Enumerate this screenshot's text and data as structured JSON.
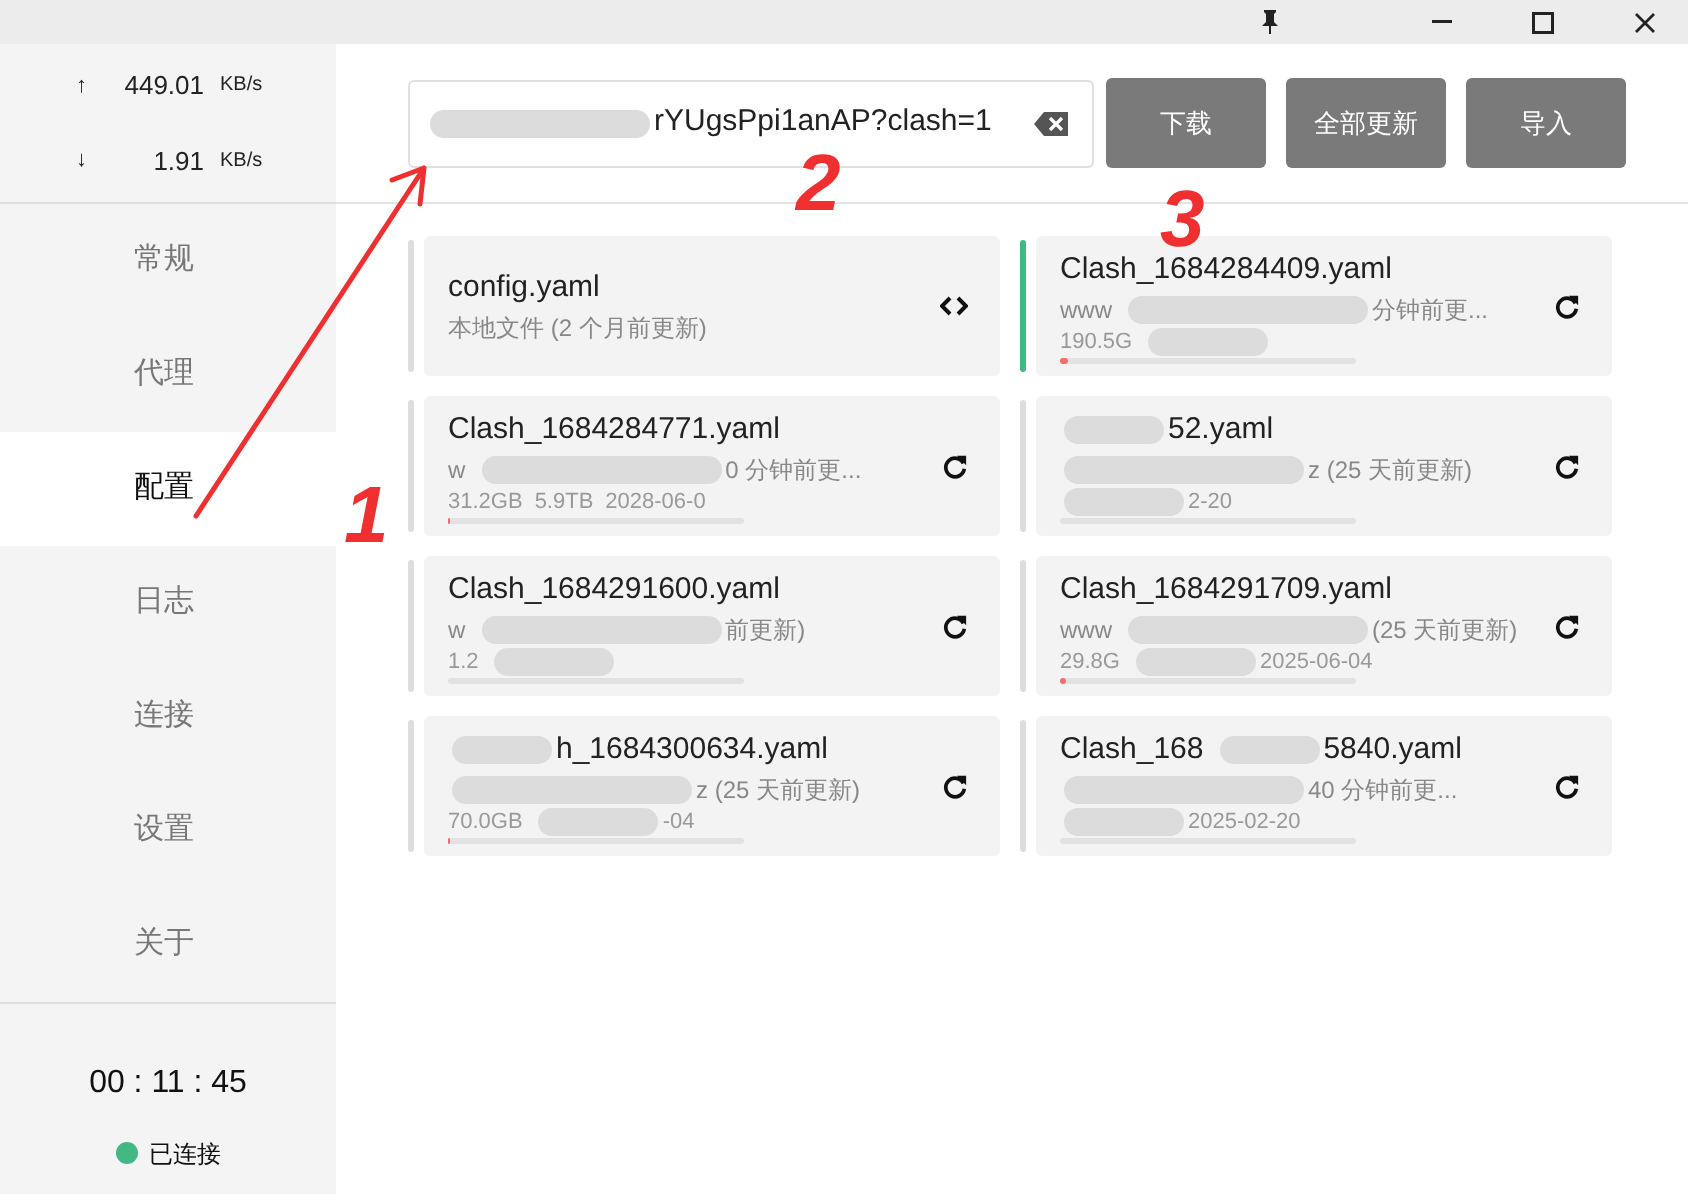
{
  "traffic": {
    "upload": {
      "arrow": "↑",
      "value": "449.01",
      "unit": "KB/s"
    },
    "download": {
      "arrow": "↓",
      "value": "1.91",
      "unit": "KB/s"
    }
  },
  "nav": [
    {
      "label": "常规",
      "selected": false
    },
    {
      "label": "代理",
      "selected": false
    },
    {
      "label": "配置",
      "selected": true
    },
    {
      "label": "日志",
      "selected": false
    },
    {
      "label": "连接",
      "selected": false
    },
    {
      "label": "设置",
      "selected": false
    },
    {
      "label": "关于",
      "selected": false
    }
  ],
  "timer": "00 : 11 : 45",
  "status": {
    "label": "已连接",
    "color": "#42b983"
  },
  "url_field": {
    "value": "rYUgsPpi1anAP?clash=1"
  },
  "buttons": [
    "下载",
    "全部更新",
    "导入"
  ],
  "profiles": [
    {
      "kind": "local",
      "selected": false,
      "title": [
        {
          "kind": "text",
          "text": "config.yaml"
        }
      ],
      "detail": [
        {
          "kind": "text",
          "text": "本地文件 (2 个月前更新)"
        }
      ]
    },
    {
      "kind": "remote",
      "selected": true,
      "title": [
        {
          "kind": "text",
          "text": "Clash_1684284409.yaml"
        }
      ],
      "detail": [
        {
          "kind": "text",
          "text": "www"
        },
        {
          "kind": "redacted"
        },
        {
          "kind": "text",
          "text": "分钟前更..."
        }
      ],
      "stats": [
        {
          "kind": "text",
          "text": "190.5G"
        },
        {
          "kind": "redacted"
        }
      ],
      "level": 0.03
    },
    {
      "kind": "remote",
      "selected": false,
      "title": [
        {
          "kind": "text",
          "text": "Clash_1684284771.yaml"
        }
      ],
      "detail": [
        {
          "kind": "text",
          "text": "w"
        },
        {
          "kind": "redacted"
        },
        {
          "kind": "text",
          "text": "0 分钟前更..."
        }
      ],
      "stats": [
        {
          "kind": "text",
          "text": "31.2GB"
        },
        {
          "kind": "text",
          "text": "5.9TB"
        },
        {
          "kind": "text",
          "text": "2028-06-0"
        }
      ],
      "level": 0.01
    },
    {
      "kind": "remote",
      "selected": false,
      "title": [
        {
          "kind": "redacted"
        },
        {
          "kind": "text",
          "text": "52.yaml"
        }
      ],
      "detail": [
        {
          "kind": "redacted"
        },
        {
          "kind": "text",
          "text": "z (25 天前更新)"
        }
      ],
      "stats": [
        {
          "kind": "redacted"
        },
        {
          "kind": "text",
          "text": "2-20"
        }
      ]
    },
    {
      "kind": "remote",
      "selected": false,
      "title": [
        {
          "kind": "text",
          "text": "Clash_1684291600.yaml"
        }
      ],
      "detail": [
        {
          "kind": "text",
          "text": "w"
        },
        {
          "kind": "redacted"
        },
        {
          "kind": "text",
          "text": "前更新)"
        }
      ],
      "stats": [
        {
          "kind": "text",
          "text": "1.2"
        },
        {
          "kind": "redacted"
        }
      ]
    },
    {
      "kind": "remote",
      "selected": false,
      "title": [
        {
          "kind": "text",
          "text": "Clash_1684291709.yaml"
        }
      ],
      "detail": [
        {
          "kind": "text",
          "text": "www"
        },
        {
          "kind": "redacted"
        },
        {
          "kind": "text",
          "text": "(25 天前更新)"
        }
      ],
      "stats": [
        {
          "kind": "text",
          "text": "29.8G"
        },
        {
          "kind": "redacted"
        },
        {
          "kind": "text",
          "text": "2025-06-04"
        }
      ],
      "level": 0.02
    },
    {
      "kind": "remote",
      "selected": false,
      "title": [
        {
          "kind": "redacted"
        },
        {
          "kind": "text",
          "text": "h_1684300634.yaml"
        }
      ],
      "detail": [
        {
          "kind": "redacted"
        },
        {
          "kind": "text",
          "text": "z (25 天前更新)"
        }
      ],
      "stats": [
        {
          "kind": "text",
          "text": "70.0GB"
        },
        {
          "kind": "redacted"
        },
        {
          "kind": "text",
          "text": "-04"
        }
      ],
      "level": 0.01
    },
    {
      "kind": "remote",
      "selected": false,
      "title": [
        {
          "kind": "text",
          "text": "Clash_168"
        },
        {
          "kind": "redacted"
        },
        {
          "kind": "text",
          "text": "5840.yaml"
        }
      ],
      "detail": [
        {
          "kind": "redacted"
        },
        {
          "kind": "text",
          "text": "40 分钟前更..."
        }
      ],
      "stats": [
        {
          "kind": "redacted"
        },
        {
          "kind": "text",
          "text": "2025-02-20"
        }
      ]
    }
  ],
  "annotations": [
    "1",
    "2",
    "3"
  ]
}
